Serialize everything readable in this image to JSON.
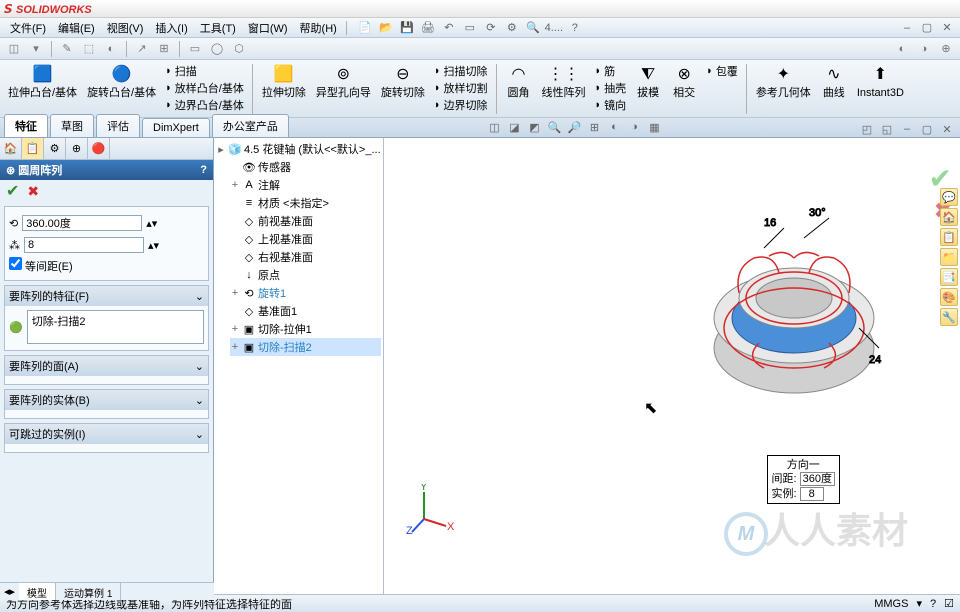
{
  "app": {
    "name": "SOLIDWORKS",
    "search_hint": "4...."
  },
  "menu": [
    "文件(F)",
    "编辑(E)",
    "视图(V)",
    "插入(I)",
    "工具(T)",
    "窗口(W)",
    "帮助(H)"
  ],
  "ribbon": {
    "big": [
      {
        "label": "拉伸凸台/基体"
      },
      {
        "label": "旋转凸台/基体"
      }
    ],
    "sub1": [
      "扫描",
      "放样凸台/基体",
      "边界凸台/基体"
    ],
    "big2": [
      {
        "label": "拉伸切除"
      },
      {
        "label": "异型孔向导"
      },
      {
        "label": "旋转切除"
      }
    ],
    "sub2": [
      "扫描切除",
      "放样切割",
      "边界切除"
    ],
    "big3": [
      {
        "label": "圆角"
      },
      {
        "label": "线性阵列"
      },
      {
        "label": "拔模"
      },
      {
        "label": "相交"
      },
      {
        "label": "参考几何体"
      },
      {
        "label": "曲线"
      },
      {
        "label": "Instant3D"
      }
    ],
    "sub3": [
      "筋",
      "抽壳",
      "镜向"
    ],
    "sub3b": [
      "包覆"
    ]
  },
  "tabs": [
    "特征",
    "草图",
    "评估",
    "DimXpert",
    "办公室产品"
  ],
  "pm": {
    "title": "圆周阵列",
    "help": "?",
    "angle": "360.00度",
    "count": "8",
    "equal": "等间距(E)",
    "sec_features": "要阵列的特征(F)",
    "feature_item": "切除-扫描2",
    "sec_faces": "要阵列的面(A)",
    "sec_bodies": "要阵列的实体(B)",
    "sec_skip": "可跳过的实例(I)"
  },
  "tree": {
    "root": "4.5 花键轴  (默认<<默认>_...",
    "items": [
      {
        "ico": "👁",
        "label": "传感器"
      },
      {
        "ico": "A",
        "label": "注解",
        "exp": "+"
      },
      {
        "ico": "≡",
        "label": "材质 <未指定>"
      },
      {
        "ico": "◇",
        "label": "前视基准面"
      },
      {
        "ico": "◇",
        "label": "上视基准面"
      },
      {
        "ico": "◇",
        "label": "右视基准面"
      },
      {
        "ico": "↓",
        "label": "原点"
      },
      {
        "ico": "⟲",
        "label": "旋转1",
        "exp": "+",
        "color": "#2a7fbf"
      },
      {
        "ico": "◇",
        "label": "基准面1"
      },
      {
        "ico": "▣",
        "label": "切除-拉伸1",
        "exp": "+"
      },
      {
        "ico": "▣",
        "label": "切除-扫描2",
        "exp": "+",
        "sel": true,
        "color": "#2a7fbf"
      }
    ]
  },
  "dimbox": {
    "title": "方向一",
    "spacing_label": "间距:",
    "spacing": "360度",
    "count_label": "实例:",
    "count": "8"
  },
  "dims": {
    "d1": "16",
    "d2": "30°",
    "d3": "24"
  },
  "bottom_tabs": [
    "模型",
    "运动算例 1"
  ],
  "status": {
    "hint": "为方向参考体选择边线或基准轴，为阵列特征选择特征的面",
    "units": "MMGS"
  },
  "triad": {
    "x": "X",
    "y": "Y",
    "z": "Z"
  }
}
